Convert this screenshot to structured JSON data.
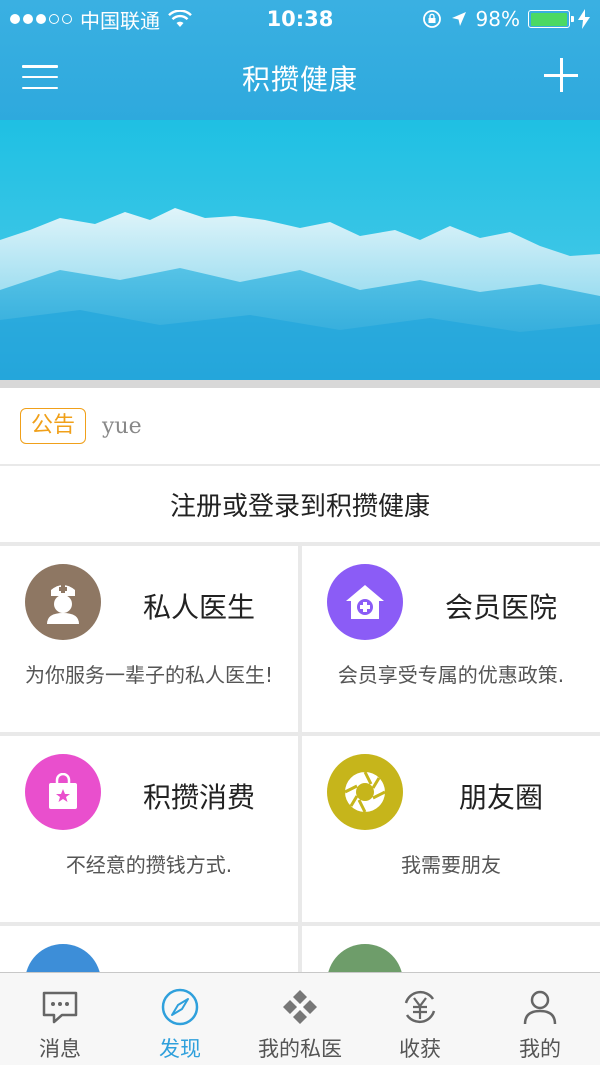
{
  "status_bar": {
    "carrier": "中国联通",
    "time": "10:38",
    "battery_percent": "98%",
    "battery_level": 0.98,
    "battery_color": "#4cd964"
  },
  "nav": {
    "title": "积攒健康",
    "menu_icon": "hamburger-menu-icon",
    "add_icon": "plus-icon"
  },
  "colors": {
    "nav_bg": "#2ea9dd",
    "accent": "#2fa0dc",
    "notice_tag": "#f0a01a"
  },
  "notice": {
    "tag": "公告",
    "text": "yue"
  },
  "register": {
    "label": "注册或登录到积攒健康"
  },
  "cards": [
    {
      "title": "私人医生",
      "desc": "为你服务一辈子的私人医生!",
      "icon": "nurse-icon",
      "color": "#8e7763"
    },
    {
      "title": "会员医院",
      "desc": "会员享受专属的优惠政策.",
      "icon": "hospital-icon",
      "color": "#8b5cf6"
    },
    {
      "title": "积攒消费",
      "desc": "不经意的攒钱方式.",
      "icon": "shopping-bag-icon",
      "color": "#e94fcd"
    },
    {
      "title": "朋友圈",
      "desc": "我需要朋友",
      "icon": "aperture-icon",
      "color": "#c6b51b"
    },
    {
      "title": "",
      "desc": "",
      "icon": "partial-icon",
      "color": "#3d8ed8"
    },
    {
      "title": "",
      "desc": "",
      "icon": "partial-icon",
      "color": "#6e9d6a"
    }
  ],
  "tabs": [
    {
      "label": "消息",
      "icon": "message-icon",
      "active": false
    },
    {
      "label": "发现",
      "icon": "compass-icon",
      "active": true
    },
    {
      "label": "我的私医",
      "icon": "clover-icon",
      "active": false
    },
    {
      "label": "收获",
      "icon": "yuan-exchange-icon",
      "active": false
    },
    {
      "label": "我的",
      "icon": "user-icon",
      "active": false
    }
  ]
}
